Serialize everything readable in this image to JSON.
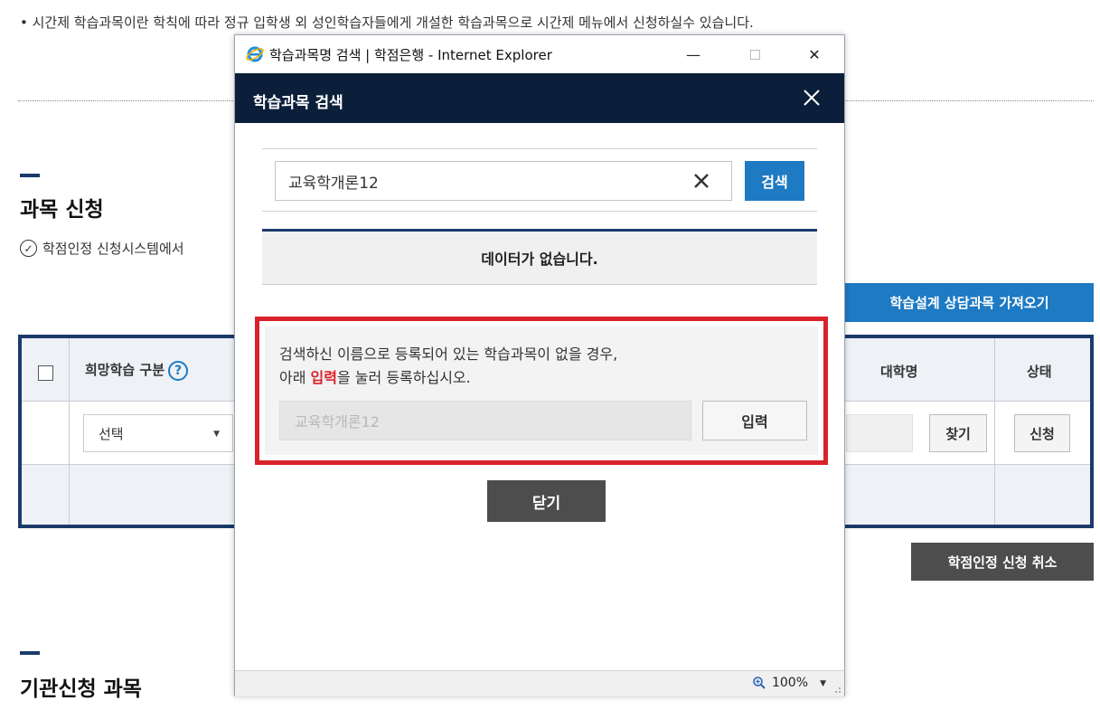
{
  "background": {
    "notice": "• 시간제 학습과목이란 학칙에 따라 정규 입학생 외 성인학습자들에게 개설한 학습과목으로 시간제 메뉴에서 신청하실수 있습니다.",
    "section1_title": "과목 신청",
    "check_text": "학점인정 신청시스템에서",
    "consult_button": "학습설계 상담과목 가져오기",
    "table": {
      "col_wish_type": "희망학습 구분",
      "help_mark": "?",
      "col_univ": "대학명",
      "col_status": "상태",
      "select_value": "선택",
      "find_button": "찾기",
      "apply_button": "신청"
    },
    "cancel_button": "학점인정 신청 취소",
    "section2_title": "기관신청 과목"
  },
  "popup": {
    "window_title": "학습과목명 검색 | 학점은행 - Internet Explorer",
    "controls": {
      "minimize": "—",
      "close": "✕"
    },
    "dialog_title": "학습과목 검색",
    "search": {
      "value": "교육학개론12",
      "button": "검색"
    },
    "no_data": "데이터가 없습니다.",
    "guide": {
      "line1": "검색하신 이름으로 등록되어 있는 학습과목이 없을 경우,",
      "line2_prefix": "아래 ",
      "line2_highlight": "입력",
      "line2_suffix": "을 눌러 등록하십시오."
    },
    "register": {
      "placeholder": "교육학개론12",
      "button": "입력"
    },
    "close_button": "닫기",
    "statusbar": {
      "zoom": "100%"
    }
  },
  "colors": {
    "navy": "#0c1f3a",
    "table_border": "#1b3a6b",
    "accent_blue": "#1d7ac3",
    "highlight_red": "#d9222b",
    "dark_button": "#4d4d4d"
  },
  "icons": [
    "ie-logo-icon",
    "check-circle-icon",
    "question-icon",
    "caret-down-icon",
    "close-icon",
    "clear-icon",
    "zoom-icon",
    "resize-grip-icon"
  ]
}
